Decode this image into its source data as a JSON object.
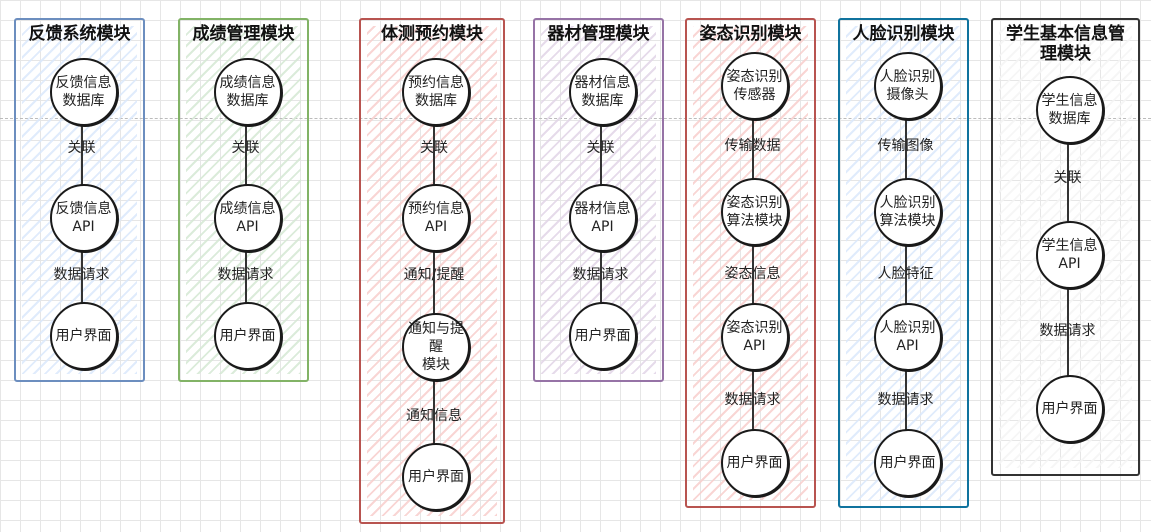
{
  "colors": {
    "feedback": "#6c8ebf",
    "grades": "#82b366",
    "booking": "#b85450",
    "equipment": "#9673a6",
    "posture": "#b85450",
    "face": "#10739e",
    "student": "#333333",
    "hatch_blue": "#dae8fc",
    "hatch_green": "#d5e8d4",
    "hatch_red": "#f8cecc",
    "hatch_purple": "#e1d5e7",
    "hatch_gray": "#f5f5f5"
  },
  "modules": [
    {
      "title": "反馈系统模块",
      "nodes": [
        "反馈信息\n数据库",
        "反馈信息\nAPI",
        "用户界面"
      ],
      "edges": [
        "关联",
        "数据请求"
      ]
    },
    {
      "title": "成绩管理模块",
      "nodes": [
        "成绩信息\n数据库",
        "成绩信息\nAPI",
        "用户界面"
      ],
      "edges": [
        "关联",
        "数据请求"
      ]
    },
    {
      "title": "体测预约模块",
      "nodes": [
        "预约信息\n数据库",
        "预约信息\nAPI",
        "通知与提醒\n模块",
        "用户界面"
      ],
      "edges": [
        "关联",
        "通知/提醒",
        "通知信息"
      ]
    },
    {
      "title": "器材管理模块",
      "nodes": [
        "器材信息\n数据库",
        "器材信息\nAPI",
        "用户界面"
      ],
      "edges": [
        "关联",
        "数据请求"
      ]
    },
    {
      "title": "姿态识别模块",
      "nodes": [
        "姿态识别\n传感器",
        "姿态识别\n算法模块",
        "姿态识别\nAPI",
        "用户界面"
      ],
      "edges": [
        "传输数据",
        "姿态信息",
        "数据请求"
      ]
    },
    {
      "title": "人脸识别模块",
      "nodes": [
        "人脸识别\n摄像头",
        "人脸识别\n算法模块",
        "人脸识别\nAPI",
        "用户界面"
      ],
      "edges": [
        "传输图像",
        "人脸特征",
        "数据请求"
      ]
    },
    {
      "title": "学生基本信息管理模块",
      "nodes": [
        "学生信息\n数据库",
        "学生信息\nAPI",
        "用户界面"
      ],
      "edges": [
        "关联",
        "数据请求"
      ]
    }
  ]
}
